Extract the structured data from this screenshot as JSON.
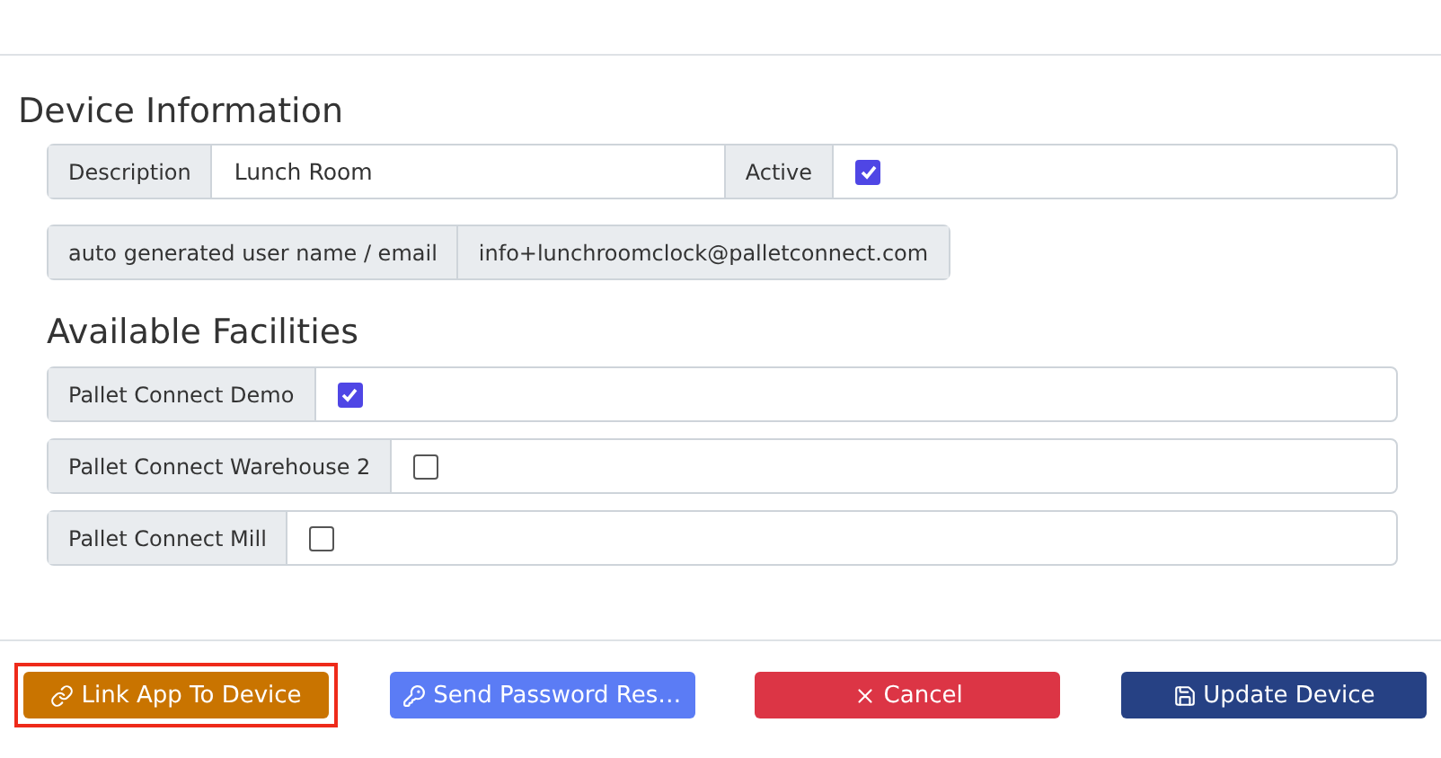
{
  "device_information": {
    "title": "Device Information",
    "description": {
      "label": "Description",
      "value": "Lunch Room"
    },
    "active": {
      "label": "Active",
      "checked": true
    },
    "username": {
      "label": "auto generated user name / email",
      "value": "info+lunchroomclock@palletconnect.com"
    }
  },
  "available_facilities": {
    "title": "Available Facilities",
    "items": [
      {
        "label": "Pallet Connect Demo",
        "checked": true
      },
      {
        "label": "Pallet Connect Warehouse 2",
        "checked": false
      },
      {
        "label": "Pallet Connect Mill",
        "checked": false
      }
    ]
  },
  "buttons": [
    {
      "kind": "link",
      "label": "Link App To Device",
      "highlighted": true
    },
    {
      "kind": "password",
      "label": "Send Password Res…",
      "highlighted": false
    },
    {
      "kind": "cancel",
      "label": "Cancel",
      "highlighted": false
    },
    {
      "kind": "update",
      "label": "Update Device",
      "highlighted": false
    }
  ]
}
